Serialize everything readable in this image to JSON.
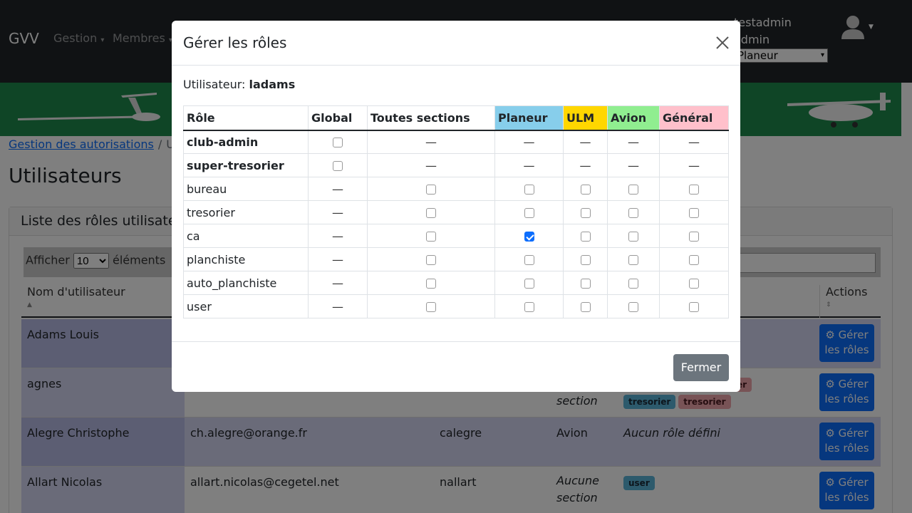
{
  "navbar": {
    "brand": "GVV",
    "menus": [
      "Gestion",
      "Membres"
    ],
    "user_name": "testadmin",
    "user_role": "admin",
    "section_selected": "Planeur"
  },
  "breadcrumb": {
    "link": "Gestion des autorisations",
    "current": "Util"
  },
  "page_title": "Utilisateurs",
  "card_title": "Liste des rôles utilisateurs",
  "datatable": {
    "show_prefix": "Afficher",
    "page_length": "10",
    "show_suffix": "éléments"
  },
  "users_table": {
    "headers": {
      "name": "Nom d'utilisateur",
      "actions": "Actions"
    },
    "action_label": "Gérer les rôles",
    "rows": [
      {
        "name": "Adams Louis",
        "email": "",
        "login": "",
        "section": "",
        "roles_text": "",
        "badges": []
      },
      {
        "name": "agnes",
        "email": "",
        "login": "",
        "section": "section",
        "roles_text": "",
        "badges": [
          "tresorier",
          "tresorier"
        ],
        "partial_badge": "er"
      },
      {
        "name": "Alegre Christophe",
        "email": "ch.alegre@orange.fr",
        "login": "calegre",
        "section": "Avion",
        "roles_text": "Aucun rôle défini",
        "badges": []
      },
      {
        "name": "Allart Nicolas",
        "email": "allart.nicolas@cegetel.net",
        "login": "nallart",
        "section": "Aucune section",
        "roles_text": "",
        "badges": [
          "user"
        ]
      }
    ]
  },
  "modal": {
    "title": "Gérer les rôles",
    "user_label": "Utilisateur:",
    "user_value": "ladams",
    "close_label": "Fermer",
    "columns": [
      {
        "label": "Rôle",
        "color": ""
      },
      {
        "label": "Global",
        "color": ""
      },
      {
        "label": "Toutes sections",
        "color": ""
      },
      {
        "label": "Planeur",
        "color": "#87ceeb"
      },
      {
        "label": "ULM",
        "color": "#ffd700"
      },
      {
        "label": "Avion",
        "color": "#90ee90"
      },
      {
        "label": "Général",
        "color": "#ffc0cb"
      }
    ],
    "dash": "—",
    "roles": [
      {
        "name": "club-admin",
        "bold": true,
        "cells": [
          "cb",
          "-",
          "-",
          "-",
          "-",
          "-"
        ]
      },
      {
        "name": "super-tresorier",
        "bold": true,
        "cells": [
          "cb",
          "-",
          "-",
          "-",
          "-",
          "-"
        ]
      },
      {
        "name": "bureau",
        "bold": false,
        "cells": [
          "-",
          "cb",
          "cb",
          "cb",
          "cb",
          "cb"
        ]
      },
      {
        "name": "tresorier",
        "bold": false,
        "cells": [
          "-",
          "cb",
          "cb",
          "cb",
          "cb",
          "cb"
        ]
      },
      {
        "name": "ca",
        "bold": false,
        "cells": [
          "-",
          "cb",
          "checked",
          "cb",
          "cb",
          "cb"
        ]
      },
      {
        "name": "planchiste",
        "bold": false,
        "cells": [
          "-",
          "cb",
          "cb",
          "cb",
          "cb",
          "cb"
        ]
      },
      {
        "name": "auto_planchiste",
        "bold": false,
        "cells": [
          "-",
          "cb",
          "cb",
          "cb",
          "cb",
          "cb"
        ]
      },
      {
        "name": "user",
        "bold": false,
        "cells": [
          "-",
          "cb",
          "cb",
          "cb",
          "cb",
          "cb"
        ]
      }
    ]
  },
  "icons": {
    "close": "close-icon",
    "avatar": "user-avatar-icon",
    "gear": "gear-icon"
  }
}
